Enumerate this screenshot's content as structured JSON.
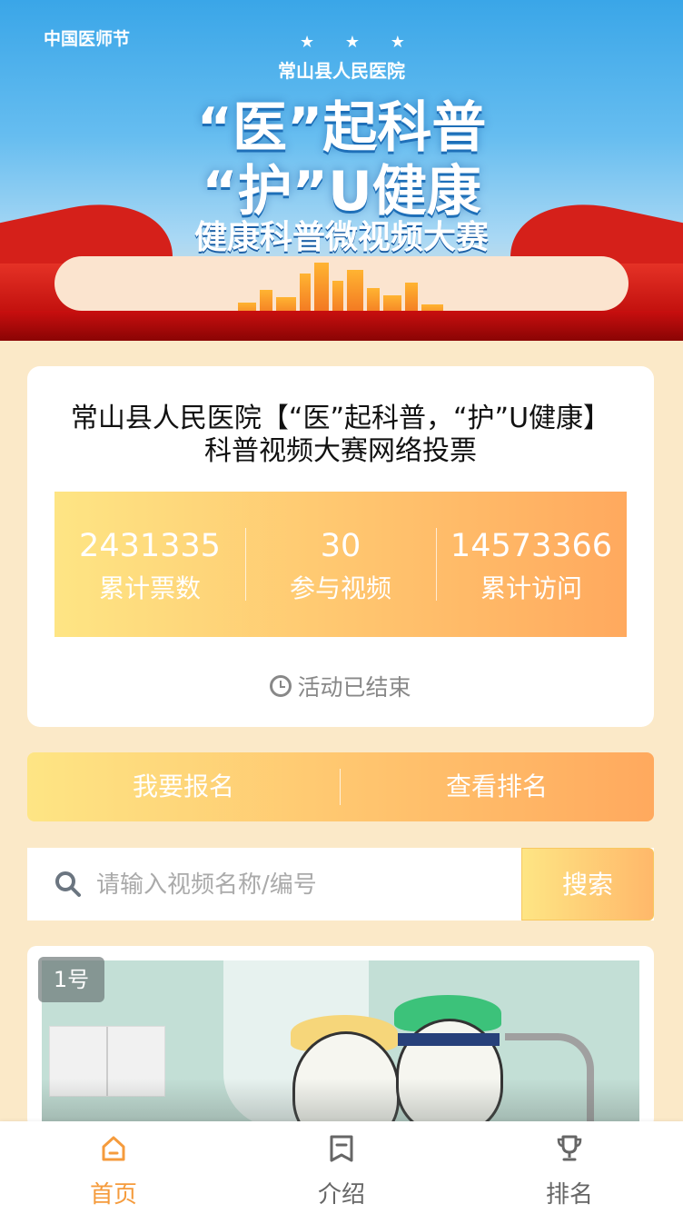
{
  "banner": {
    "top_label": "中国医师节",
    "stars": "★ ★ ★",
    "hospital": "常山县人民医院",
    "slogan_line1": "“医”起科普",
    "slogan_line2": "“护”U健康",
    "subtitle": "健康科普微视频大赛"
  },
  "event": {
    "title": "常山县人民医院【“医”起科普，“护”U健康】科普视频大赛网络投票",
    "stats": [
      {
        "value": "2431335",
        "label": "累计票数"
      },
      {
        "value": "30",
        "label": "参与视频"
      },
      {
        "value": "14573366",
        "label": "累计访问"
      }
    ],
    "status": "活动已结束"
  },
  "actions": {
    "signup_label": "我要报名",
    "ranking_label": "查看排名"
  },
  "search": {
    "placeholder": "请输入视频名称/编号",
    "value": "",
    "button_label": "搜索"
  },
  "videos": [
    {
      "number_badge": "1号"
    }
  ],
  "tabbar": {
    "items": [
      {
        "label": "首页",
        "icon": "home-icon",
        "active": true
      },
      {
        "label": "介绍",
        "icon": "bookmark-icon",
        "active": false
      },
      {
        "label": "排名",
        "icon": "trophy-icon",
        "active": false
      }
    ]
  },
  "colors": {
    "accent_orange": "#f59b3c",
    "gradient_start": "#fee584",
    "gradient_end": "#ffa95e",
    "page_background": "#fbe9c8"
  }
}
